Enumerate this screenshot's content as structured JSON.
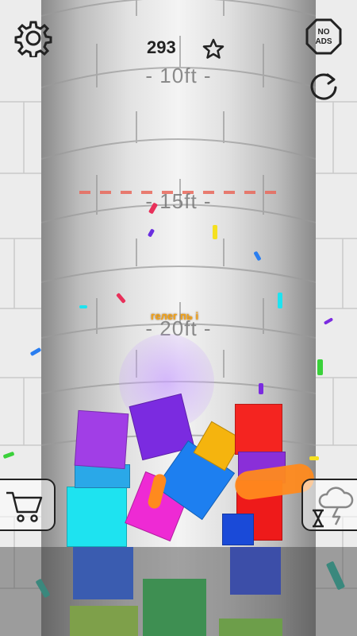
{
  "hud": {
    "score": "293",
    "current_height": "- 10ft -",
    "no_ads_line1": "NO",
    "no_ads_line2": "ADS"
  },
  "tower_markers": [
    {
      "label": "- 15ft -"
    },
    {
      "label": "- 20ft -"
    }
  ],
  "combo_text": "гелег пь і",
  "icons": {
    "settings": "gear-icon",
    "best_score": "star-icon",
    "no_ads": "no-ads-octagon-icon",
    "restart": "restart-icon",
    "shop": "cart-icon",
    "weather": "storm-cloud-icon",
    "timer": "hourglass-icon"
  },
  "colors": {
    "record_line": "#e9695c",
    "text_dark": "#222222"
  }
}
